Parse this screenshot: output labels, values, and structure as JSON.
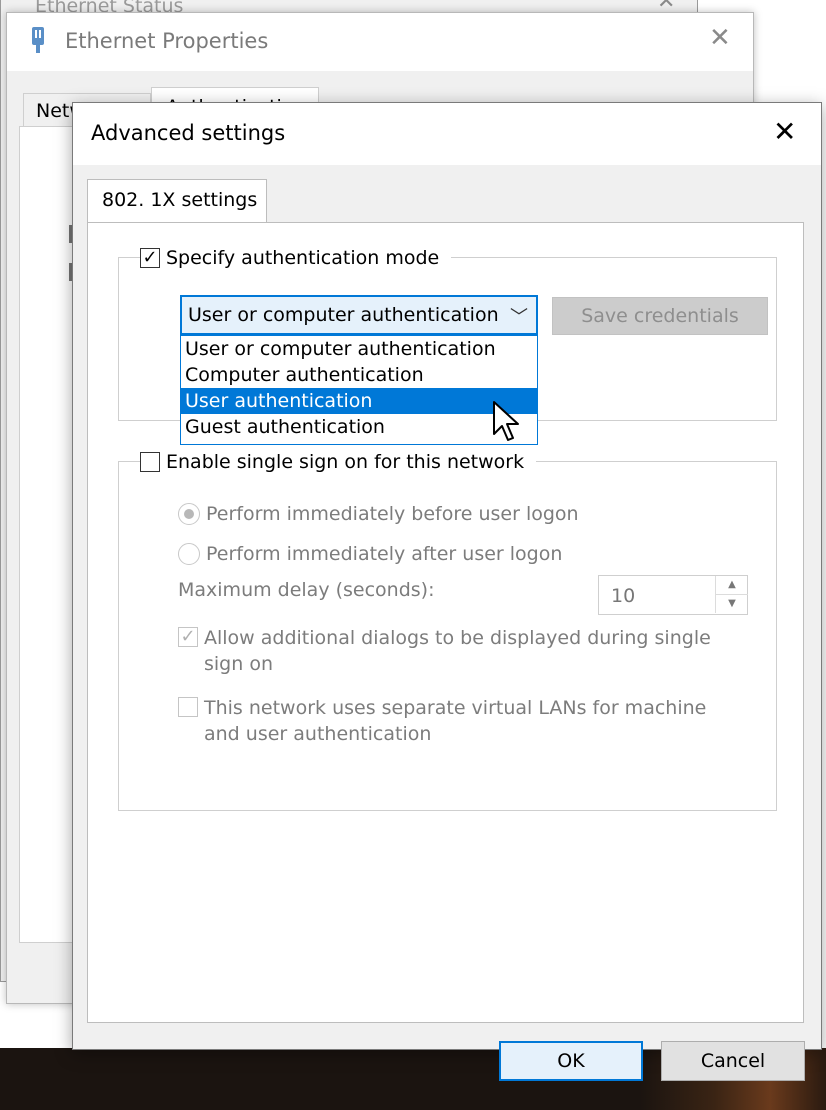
{
  "background": {
    "status_window": {
      "title": "Ethernet Status",
      "close_icon": "close-icon"
    },
    "properties_window": {
      "title": "Ethernet Properties",
      "close_icon": "close-icon",
      "tabs": [
        {
          "label": "Networking"
        },
        {
          "label": "Authentication"
        }
      ]
    }
  },
  "dialog": {
    "title": "Advanced settings",
    "close_glyph": "✕",
    "tab_label": "802. 1X settings",
    "auth_mode": {
      "checkbox_label": "Specify authentication mode",
      "checked": true,
      "combo_value": "User or computer authentication",
      "save_credentials_label": "Save credentials",
      "options": [
        {
          "label": "User or computer authentication",
          "selected": false
        },
        {
          "label": "Computer authentication",
          "selected": false
        },
        {
          "label": "User authentication",
          "selected": true
        },
        {
          "label": "Guest authentication",
          "selected": false
        }
      ]
    },
    "sso": {
      "checkbox_label": "Enable single sign on for this network",
      "checked": false,
      "radio_before": "Perform immediately before user logon",
      "radio_after": "Perform immediately after user logon",
      "max_delay_label": "Maximum delay (seconds):",
      "max_delay_value": "10",
      "allow_dialogs_label": "Allow additional dialogs to be displayed during single sign on",
      "allow_dialogs_checked": true,
      "vlan_label": "This network uses separate virtual LANs for machine and user authentication",
      "vlan_checked": false
    },
    "buttons": {
      "ok": "OK",
      "cancel": "Cancel"
    }
  },
  "colors": {
    "accent": "#0078d7",
    "disabled_text": "#7c7c7c"
  }
}
